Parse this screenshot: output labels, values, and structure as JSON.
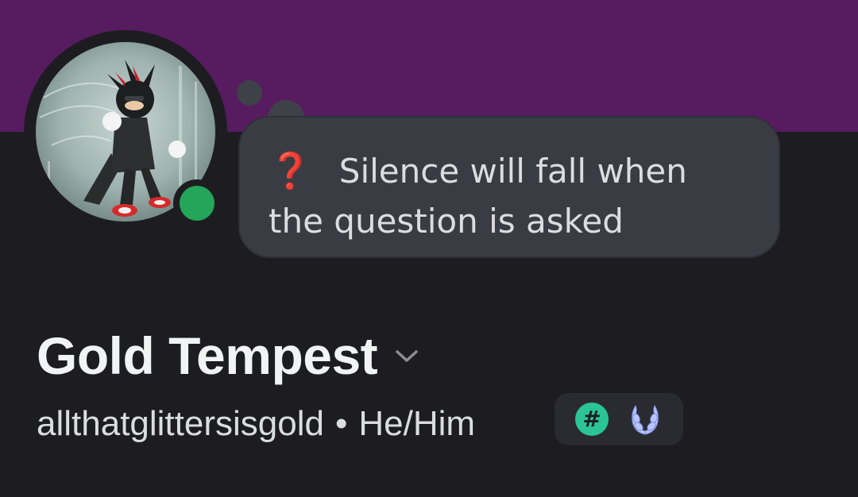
{
  "profile": {
    "display_name": "Gold Tempest",
    "username": "allthatglittersisgold",
    "separator": "•",
    "pronouns": "He/Him",
    "online_status": "online",
    "custom_status": {
      "emoji": "❓",
      "text": "Silence will fall when the question is asked"
    },
    "badges": [
      {
        "name": "hash-badge",
        "symbol": "#"
      },
      {
        "name": "laurel-badge"
      }
    ]
  },
  "colors": {
    "banner": "#571b60",
    "background": "#1d1d21",
    "status_online": "#23a55a",
    "bubble": "#3a3c43",
    "hash_badge": "#2bc497",
    "laurel_badge": "#b7c4ff"
  }
}
